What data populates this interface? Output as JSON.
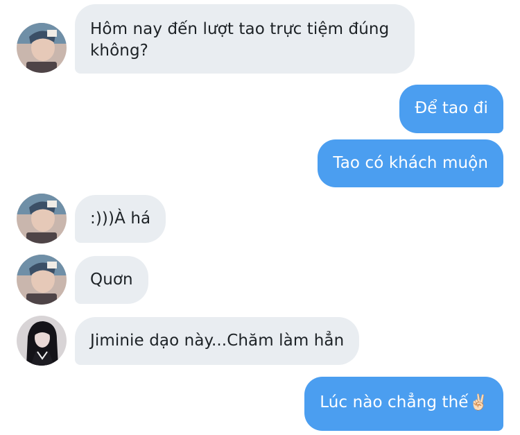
{
  "messages": [
    {
      "side": "in",
      "avatar": "avatar-boy",
      "text": "Hôm nay đến lượt tao trực tiệm đúng không?"
    },
    {
      "side": "out",
      "text": "Để tao đi"
    },
    {
      "side": "out",
      "text": "Tao có khách muộn"
    },
    {
      "side": "in",
      "avatar": "avatar-boy",
      "text": ":)))À há"
    },
    {
      "side": "in",
      "avatar": "avatar-boy",
      "text": "Quơn"
    },
    {
      "side": "in",
      "avatar": "avatar-girl",
      "text": "Jiminie dạo này...Chăm làm hẳn"
    },
    {
      "side": "out",
      "text": "Lúc nào chẳng thế",
      "emoji": "✌🏻"
    }
  ],
  "colors": {
    "incoming_bubble": "#e9edf1",
    "outgoing_bubble": "#4b9ef0",
    "incoming_text": "#1d2226",
    "outgoing_text": "#ffffff"
  }
}
